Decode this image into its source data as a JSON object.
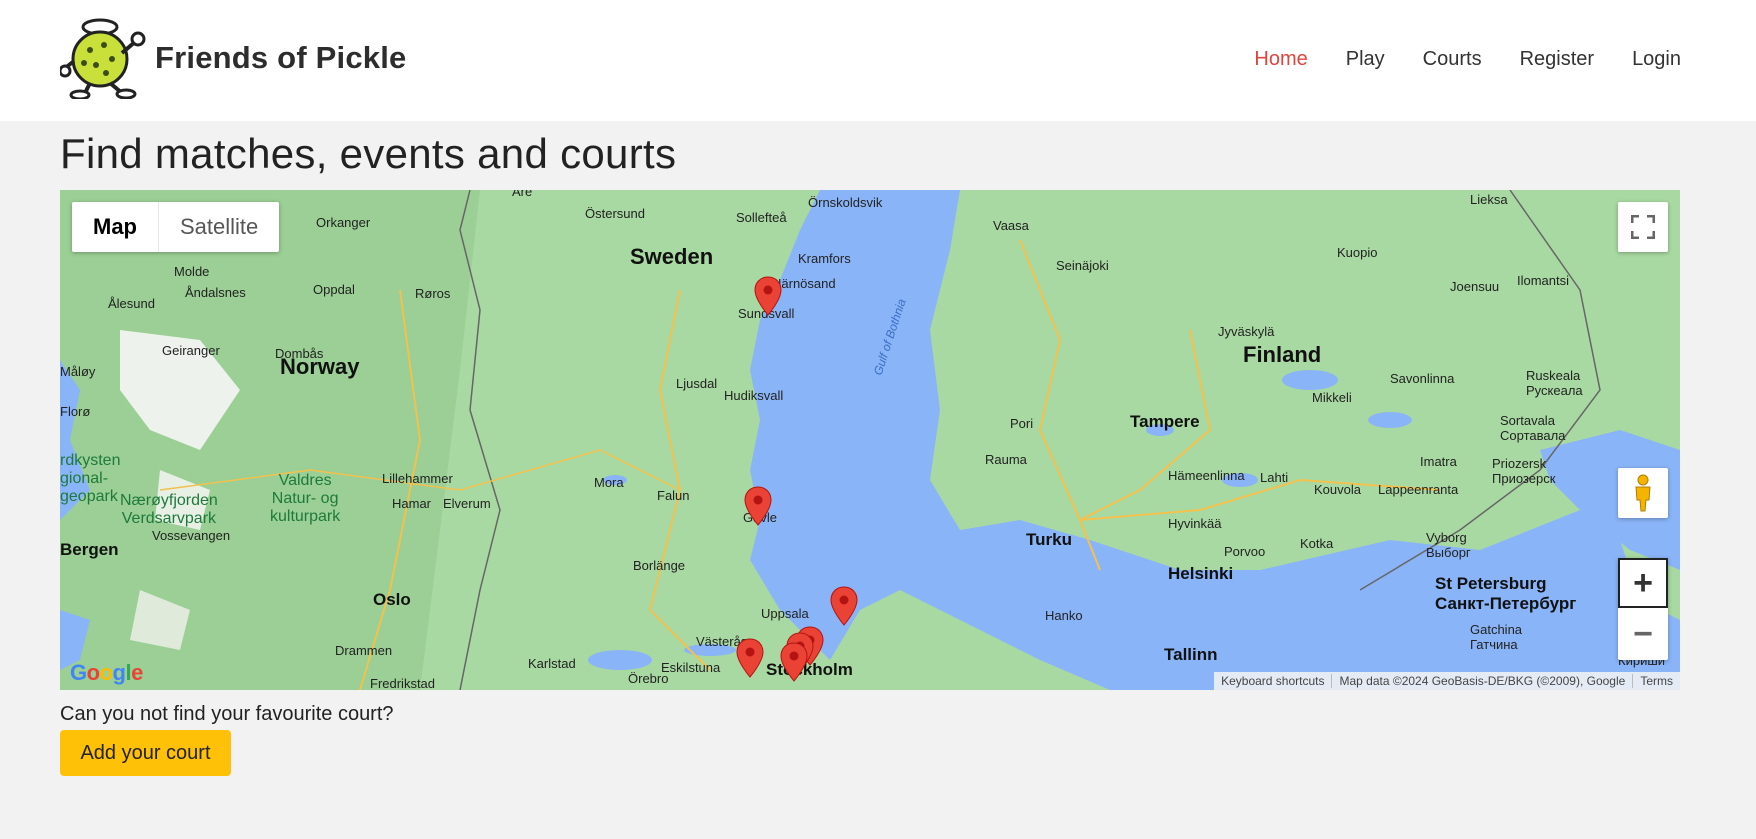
{
  "brand": {
    "name": "Friends of Pickle"
  },
  "nav": {
    "home": "Home",
    "play": "Play",
    "courts": "Courts",
    "register": "Register",
    "login": "Login",
    "active_color": "#e0443d"
  },
  "page": {
    "title": "Find matches, events and courts"
  },
  "map": {
    "type_map": "Map",
    "type_satellite": "Satellite",
    "zoom_in": "+",
    "zoom_out": "−",
    "google": "Google",
    "attribution": {
      "shortcuts": "Keyboard shortcuts",
      "data": "Map data ©2024 GeoBasis-DE/BKG (©2009), Google",
      "terms": "Terms"
    },
    "labels": {
      "sweden": "Sweden",
      "norway": "Norway",
      "finland": "Finland",
      "gulf": "Gulf of Bothnia",
      "ostersund": "Östersund",
      "solleftea": "Sollefteå",
      "ornskoldsvik": "Örnskoldsvik",
      "are": "Åre",
      "kramfors": "Kramfors",
      "harnosand": "Härnösand",
      "sundsvall": "Sundsvall",
      "ljusdal": "Ljusdal",
      "hudiksvall": "Hudiksvall",
      "mora": "Mora",
      "falun": "Falun",
      "gavle": "Gävle",
      "borlange": "Borlänge",
      "uppsala": "Uppsala",
      "vasteras": "Västerås",
      "eskilstuna": "Eskilstuna",
      "karlstad": "Karlstad",
      "orebro": "Örebro",
      "stockholm": "Stockholm",
      "orkanger": "Orkanger",
      "molde": "Molde",
      "andalsnes": "Åndalsnes",
      "alesund": "Ålesund",
      "oppdal": "Oppdal",
      "roros": "Røros",
      "geiranger": "Geiranger",
      "dombas": "Dombås",
      "malov": "Måløy",
      "floro": "Florø",
      "lillehammer": "Lillehammer",
      "hamar": "Hamar",
      "elverum": "Elverum",
      "bergen": "Bergen",
      "vossevangen": "Vossevangen",
      "oslo": "Oslo",
      "drammen": "Drammen",
      "fredrikstad": "Fredrikstad",
      "vaasa": "Vaasa",
      "seinajoki": "Seinäjoki",
      "kuopio": "Kuopio",
      "joensuu": "Joensuu",
      "ilomantsi": "Ilomantsi",
      "lieksa": "Lieksa",
      "jyvaskyla": "Jyväskylä",
      "mikkeli": "Mikkeli",
      "savonlinna": "Savonlinna",
      "ruskeala": "Ruskeala\nРускеала",
      "sortavala": "Sortavala\nСортавала",
      "pori": "Pori",
      "tampere": "Tampere",
      "rauma": "Rauma",
      "hameenlinna": "Hämeenlinna",
      "lahti": "Lahti",
      "kouvola": "Kouvola",
      "lappeenranta": "Lappeenranta",
      "imatra": "Imatra",
      "priozersk": "Priozersk\nПриозерск",
      "turku": "Turku",
      "hyvinkaa": "Hyvinkää",
      "porvoo": "Porvoo",
      "kotka": "Kotka",
      "vyborg": "Vyborg\nВыборг",
      "helsinki": "Helsinki",
      "hanko": "Hanko",
      "tallinn": "Tallinn",
      "stpetersburg": "St Petersburg\nСанкт-Петербург",
      "gatchina": "Gatchina\nГатчина",
      "kirish": "Kirish\nКириши",
      "valdres": "Valdres\nNatur- og\nkulturpark",
      "naeroy": "Nærøyfjorden\nVerdsarvpark",
      "geopark": "rdkysten\ngional-\ngeopark"
    }
  },
  "footer": {
    "question": "Can you not find your favourite court?",
    "add_button": "Add your court",
    "button_color": "#ffc107"
  }
}
